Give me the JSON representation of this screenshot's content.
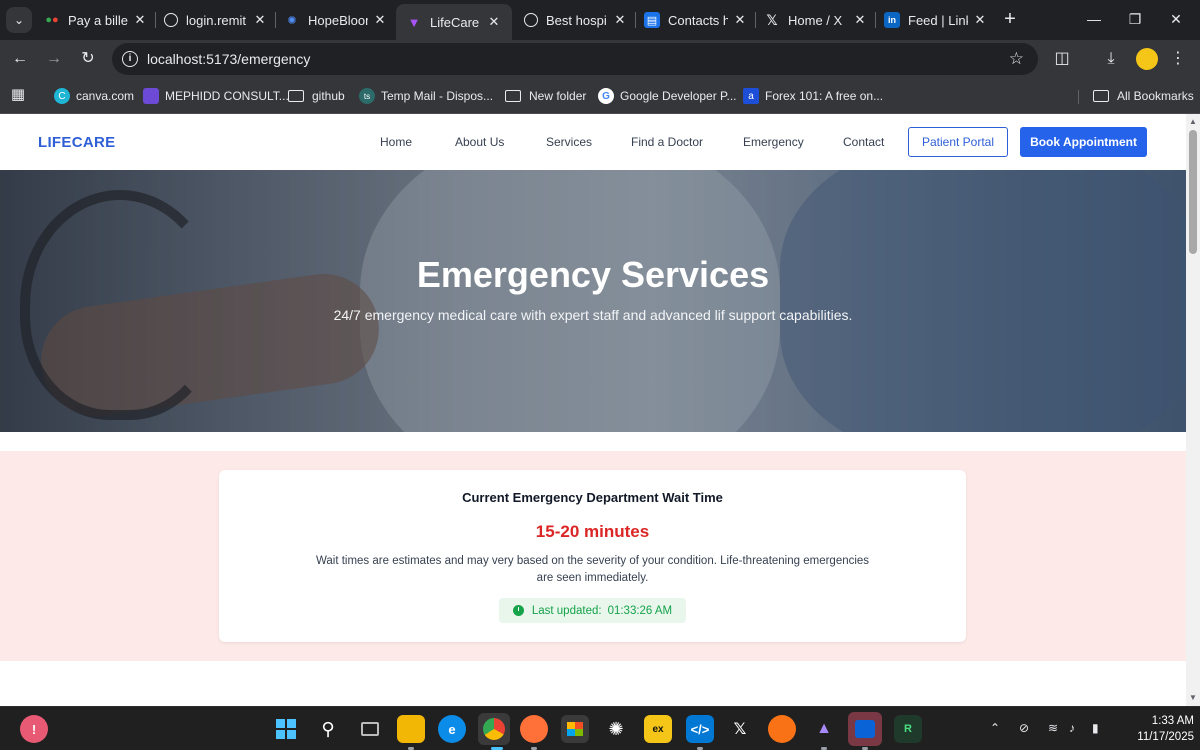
{
  "browser": {
    "tabs": [
      {
        "label": "Pay a biller",
        "active": false
      },
      {
        "label": "login.remit",
        "active": false
      },
      {
        "label": "HopeBloom",
        "active": false
      },
      {
        "label": "LifeCare",
        "active": true
      },
      {
        "label": "Best hospi",
        "active": false
      },
      {
        "label": "Contacts h",
        "active": false
      },
      {
        "label": "Home / X",
        "active": false
      },
      {
        "label": "Feed | Link",
        "active": false
      }
    ],
    "url": "localhost:5173/emergency",
    "bookmarks": [
      {
        "label": "canva.com",
        "icon": "canva-icon"
      },
      {
        "label": "MEPHIDD CONSULT...",
        "icon": "mephidd-icon"
      },
      {
        "label": "github",
        "icon": "folder-icon"
      },
      {
        "label": "Temp Mail - Dispos...",
        "icon": "tempmail-icon"
      },
      {
        "label": "New folder",
        "icon": "folder-icon"
      },
      {
        "label": "Google Developer P...",
        "icon": "google-icon"
      },
      {
        "label": "Forex 101: A free on...",
        "icon": "forex-icon"
      }
    ],
    "all_bookmarks": "All Bookmarks"
  },
  "site": {
    "logo": "LIFECARE",
    "nav": [
      "Home",
      "About Us",
      "Services",
      "Find a Doctor",
      "Emergency",
      "Contact"
    ],
    "patient_portal": "Patient Portal",
    "book_appointment": "Book Appointment",
    "hero": {
      "title": "Emergency Services",
      "subtitle": "24/7 emergency medical care with expert staff and advanced lif support capabilities."
    },
    "wait": {
      "title": "Current Emergency Department Wait Time",
      "time": "15-20 minutes",
      "note": "Wait times are estimates and may very based on the severity of your condition. Life-threatening emergencies are seen immediately.",
      "updated_label": "Last updated:",
      "updated_time": "01:33:26 AM"
    }
  },
  "taskbar": {
    "time": "1:33 AM",
    "date": "11/17/2025"
  },
  "colors": {
    "brand": "#2563eb",
    "alert": "#dc2626",
    "success": "#16a34a",
    "wait_bg": "#fde9e7"
  }
}
